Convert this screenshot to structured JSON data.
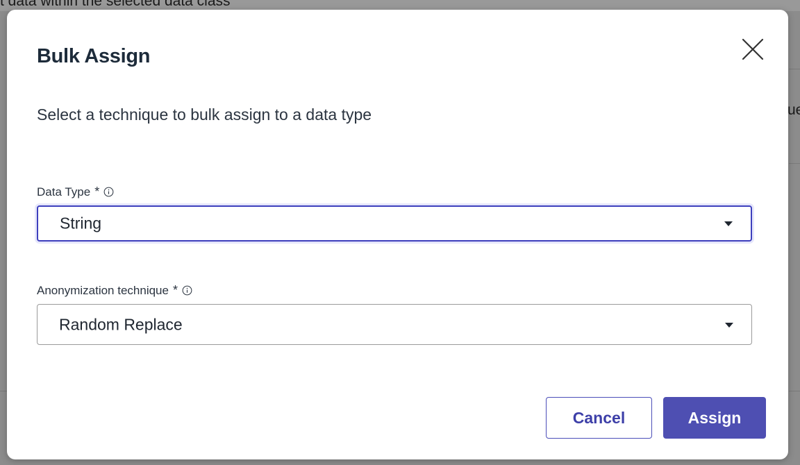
{
  "background": {
    "top_text": "t data within the selected data class",
    "right_text": "ue"
  },
  "modal": {
    "title": "Bulk Assign",
    "description": "Select a technique to bulk assign to a data type",
    "close_icon": "close-icon",
    "fields": {
      "data_type": {
        "label": "Data Type",
        "required_mark": "*",
        "info_icon": "info-icon",
        "value": "String"
      },
      "technique": {
        "label": "Anonymization technique",
        "required_mark": "*",
        "info_icon": "info-icon",
        "value": "Random Replace"
      }
    },
    "buttons": {
      "cancel": "Cancel",
      "assign": "Assign"
    }
  },
  "colors": {
    "accent": "#4e4fb2",
    "focus_border": "#3d3fbd",
    "title_text": "#1d2b3a"
  }
}
